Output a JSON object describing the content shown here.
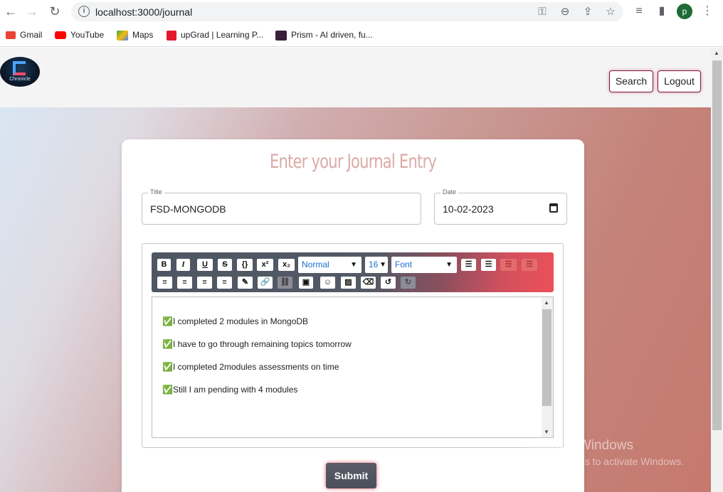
{
  "browser": {
    "url": "localhost:3000/journal",
    "profile_initial": "p",
    "bookmarks": [
      {
        "label": "Gmail",
        "color": "#ea4335"
      },
      {
        "label": "YouTube",
        "color": "#ff0000"
      },
      {
        "label": "Maps",
        "color": "#34a853"
      },
      {
        "label": "upGrad | Learning P...",
        "color": "#e4172b"
      },
      {
        "label": "Prism - AI driven, fu...",
        "color": "#3a1f3a"
      }
    ]
  },
  "header": {
    "logo_text": "Chronicle",
    "search_label": "Search",
    "logout_label": "Logout"
  },
  "form": {
    "heading": "Enter your Journal Entry",
    "title_label": "Title",
    "title_value": "FSD-MONGODB",
    "date_label": "Date",
    "date_value": "10-02-2023",
    "submit_label": "Submit"
  },
  "editor": {
    "toolbar": {
      "bold": "B",
      "italic": "I",
      "underline": "U",
      "strike": "S",
      "code": "{}",
      "superscript": "x²",
      "subscript": "x₂",
      "format_select": "Normal",
      "size_select": "16",
      "font_select": "Font"
    },
    "lines": [
      "✅I completed 2 modules in MongoDB",
      "✅I have to go through remaining topics tomorrow",
      "✅I completed 2modules  assessments on time",
      "✅Still I am pending with 4 modules"
    ]
  },
  "watermark": {
    "line1": "Activate Windows",
    "line2": "Go to Settings to activate Windows."
  }
}
